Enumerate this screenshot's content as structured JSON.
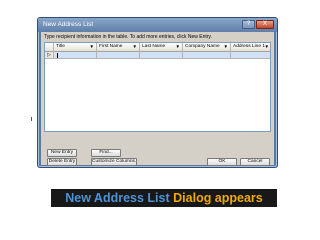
{
  "dialog": {
    "title": "New Address List",
    "help_label": "?",
    "close_label": "X",
    "instructions": "Type recipient information in the table. To add more entries, click New Entry.",
    "columns": [
      {
        "label": "Title"
      },
      {
        "label": "First Name"
      },
      {
        "label": "Last Name"
      },
      {
        "label": "Company Name"
      },
      {
        "label": "Address Line 1"
      }
    ],
    "row_indicator": "▷",
    "buttons": {
      "new_entry": "New Entry",
      "find": "Find...",
      "delete_entry": "Delete Entry",
      "customize_columns": "Customize Columns...",
      "ok": "OK",
      "cancel": "Cancel"
    }
  },
  "caption": {
    "part1": "New Address List",
    "part2": "Dialog appears"
  },
  "colors": {
    "caption_blue": "#4c93d8",
    "caption_orange": "#f2a900",
    "titlebar": "#6f8fb8",
    "selected_row": "#cfe0f7"
  }
}
